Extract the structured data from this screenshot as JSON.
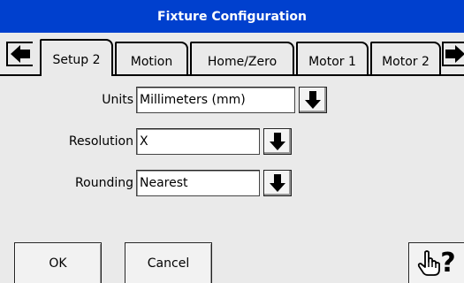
{
  "window": {
    "title": "Fixture Configuration"
  },
  "tabs": {
    "prev_icon": "arrow-left-icon",
    "next_icon": "arrow-right-icon",
    "items": [
      {
        "label": "Setup 2",
        "active": true
      },
      {
        "label": "Motion",
        "active": false
      },
      {
        "label": "Home/Zero",
        "active": false
      },
      {
        "label": "Motor 1",
        "active": false
      },
      {
        "label": "Motor 2",
        "active": false
      }
    ]
  },
  "form": {
    "units": {
      "label": "Units",
      "value": "Millimeters (mm)"
    },
    "resolution": {
      "label": "Resolution",
      "value": "X"
    },
    "rounding": {
      "label": "Rounding",
      "value": "Nearest"
    },
    "dropdown_icon": "arrow-down-icon"
  },
  "footer": {
    "ok_label": "OK",
    "cancel_label": "Cancel",
    "help_icon": "pointing-hand-icon",
    "help_mark": "?"
  },
  "colors": {
    "titlebar": "#0040ce",
    "background": "#eaeaea"
  }
}
